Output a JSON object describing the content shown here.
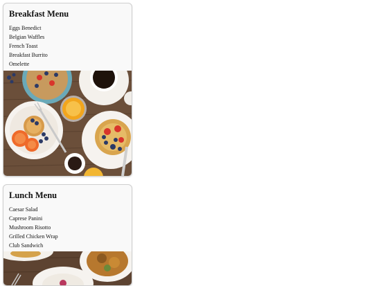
{
  "menus": {
    "breakfast": {
      "title": "Breakfast Menu",
      "items": [
        "Eggs Benedict",
        "Belgian Waffles",
        "French Toast",
        "Breakfast Burrito",
        "Omelette"
      ]
    },
    "lunch": {
      "title": "Lunch Menu",
      "items": [
        "Caesar Salad",
        "Caprese Panini",
        "Mushroom Risotto",
        "Grilled Chicken Wrap",
        "Club Sandwich"
      ]
    }
  },
  "colors": {
    "card_background": "#f9f9f9",
    "card_border": "#cfcfcf",
    "table_wood": "#6b4f3a"
  }
}
